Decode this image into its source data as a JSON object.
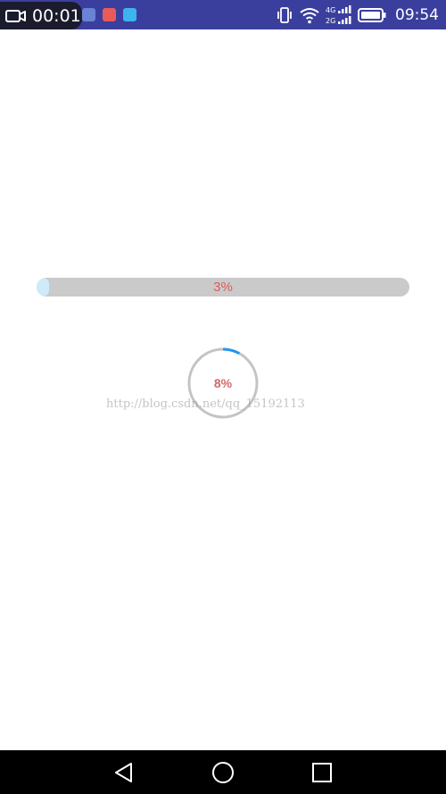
{
  "status_bar": {
    "recording_timer": "00:01",
    "time": "09:54",
    "network_top": "4G",
    "network_bottom": "2G",
    "notification_icons": [
      "app-icon-1",
      "app-icon-2",
      "app-icon-3"
    ],
    "colors": {
      "background": "#3a3f9e"
    }
  },
  "progress_bar": {
    "label": "3%",
    "value": 0.03,
    "colors": {
      "track": "#cacaca",
      "fill": "#cfeaf9",
      "text": "#e05a5a"
    }
  },
  "circular_progress": {
    "label": "8%",
    "value": 0.08,
    "colors": {
      "track": "#c4c4c4",
      "arc": "#2196f3",
      "text": "#d06a6a"
    }
  },
  "watermark": {
    "text": "http://blog.csdn.net/qq_15192113"
  },
  "nav_bar": {
    "buttons": [
      "back-icon",
      "home-icon",
      "recents-icon"
    ]
  }
}
